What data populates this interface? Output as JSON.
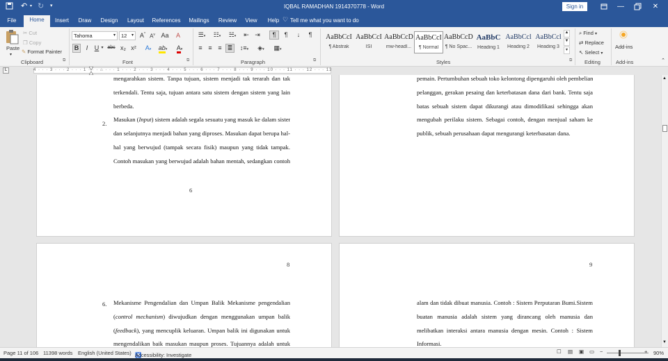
{
  "window": {
    "title": "IQBAL RAMADHAN 1914370778  -  Word",
    "sign_in": "Sign in"
  },
  "tabs": [
    "File",
    "Home",
    "Insert",
    "Draw",
    "Design",
    "Layout",
    "References",
    "Mailings",
    "Review",
    "View",
    "Help"
  ],
  "active_tab": "Home",
  "tell_me": "Tell me what you want to do",
  "ribbon": {
    "clipboard": {
      "paste": "Paste",
      "cut": "Cut",
      "copy": "Copy",
      "format_painter": "Format Painter",
      "label": "Clipboard"
    },
    "font": {
      "name": "Tahoma",
      "size": "12",
      "label": "Font",
      "bold": "B",
      "italic": "I",
      "underline": "U",
      "strike": "abc",
      "sub": "x₂",
      "sup": "x²",
      "grow": "A",
      "shrink": "A",
      "case": "Aa",
      "clear": "A",
      "effects": "A",
      "highlight": "ab",
      "color": "A"
    },
    "paragraph": {
      "label": "Paragraph"
    },
    "styles": {
      "label": "Styles",
      "items": [
        {
          "preview": "AaBbCcI",
          "name": "¶ Abstrak"
        },
        {
          "preview": "AaBbCcI",
          "name": "ISI"
        },
        {
          "preview": "AaBbCcD",
          "name": "mw-headl..."
        },
        {
          "preview": "AaBbCcI",
          "name": "¶ Normal"
        },
        {
          "preview": "AaBbCcDc",
          "name": "¶ No Spac..."
        },
        {
          "preview": "AaBbC",
          "name": "Heading 1"
        },
        {
          "preview": "AaBbCcl",
          "name": "Heading 2"
        },
        {
          "preview": "AaBbCcl",
          "name": "Heading 3"
        }
      ],
      "selected_index": 3
    },
    "editing": {
      "find": "Find",
      "replace": "Replace",
      "select": "Select",
      "label": "Editing"
    },
    "addins": {
      "button": "Add-ins",
      "label": "Add-ins"
    }
  },
  "ruler": {
    "marks": "4 · · · 3 · · · 2 · · · 1 · · · ⌂ · · · 1 · · · 2 · · · 3 · · · 4 · · · 5 · · · 6 · · · 7 · · · 8 · · · 9 · · · 10 · · · 11 · · · 12 · · · 13 · · · 14 · · · 15 · · · 16 ·",
    "tab_selector": "L"
  },
  "pages": {
    "page6": {
      "lines": [
        "mengarahkan sistem. Tanpa tujuan, sistem menjadi tak terarah dan tak",
        "terkendali. Tentu saja, tujuan antara satu sistem dengan sistem yang lain",
        "berbeda."
      ],
      "item_number": "2.",
      "item_lines": [
        "Masukan (Input) sistem adalah segala sesuatu yang masuk ke dalam sistem",
        "dan selanjutnya menjadi bahan yang diproses. Masukan dapat berupa hal-",
        "hal yang berwujud (tampak secara fisik) maupun yang tidak tampak.",
        "Contoh masukan yang berwujud adalah bahan mentah, sedangkan contoh"
      ],
      "page_number": "6"
    },
    "page7": {
      "lines": [
        "pemain. Pertumbuhan sebuah toko kelontong dipengaruhi oleh pembelian",
        "pelanggan, gerakan pesaing dan keterbatasan dana dari bank. Tentu saja",
        "batas sebuah sistem dapat dikurangi atau dimodifikasi sehingga akan",
        "mengubah perilaku sistem. Sebagai contoh, dengan menjual saham ke",
        "publik, sebuah perusahaan dapat mengurangi keterbasatan dana."
      ]
    },
    "page8": {
      "page_number": "8",
      "item_number": "6.",
      "item_lines": [
        "Mekanisme Pengendalian dan Umpan Balik Mekanisme pengendalian",
        "(control mechanism) diwujudkan dengan menggunakan umpan balik",
        "(feedback), yang mencuplik keluaran. Umpan balik ini digunakan untuk",
        "mengendalikan baik masukan maupun proses. Tujuannya adalah untuk"
      ]
    },
    "page9": {
      "page_number": "9",
      "lines": [
        "alam dan tidak dibuat manusia. Contoh : Sistem Perputaran Bumi.Sistem",
        "buatan manusia adalah sistem yang dirancang oleh manusia dan",
        "melibatkan interaksi antara manusia dengan mesin. Contoh : Sistem",
        "Informasi."
      ]
    }
  },
  "status": {
    "page": "Page 11 of 106",
    "words": "11398 words",
    "language": "English (United States)",
    "accessibility": "Accessibility: Investigate",
    "zoom": "90%"
  },
  "colors": {
    "brand": "#2b579a",
    "ribbon": "#f3f3f3",
    "canvas": "#e6e6e6"
  }
}
